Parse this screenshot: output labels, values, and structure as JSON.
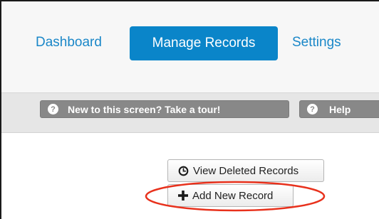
{
  "nav": {
    "items": [
      {
        "label": "Dashboard"
      },
      {
        "label": "Manage Records",
        "active": true
      },
      {
        "label": "Settings"
      }
    ],
    "active_color": "#0a85c9",
    "link_color": "#1a87c8"
  },
  "help_strip": {
    "tour_label": "New to this screen? Take a tour!",
    "help_label": "Help",
    "icon": "question-circle-icon",
    "icon_glyph": "?"
  },
  "actions": {
    "view_deleted_label": "View Deleted Records",
    "view_deleted_icon": "clock-icon",
    "add_new_label": "Add New Record",
    "add_new_icon": "plus-icon"
  },
  "annotation": {
    "highlight_color": "#e8311c",
    "highlighted": "Add New Record"
  }
}
